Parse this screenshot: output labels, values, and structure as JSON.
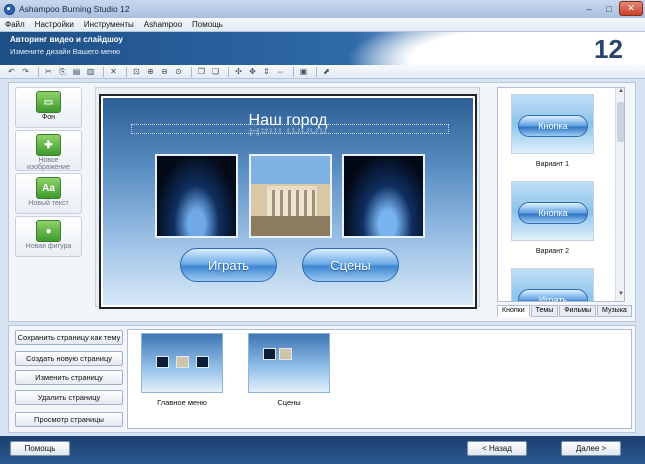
{
  "window": {
    "title": "Ashampoo Burning Studio 12",
    "controls": {
      "minimize": "–",
      "maximize": "□",
      "close": "✕"
    }
  },
  "menu": [
    "Файл",
    "Настройки",
    "Инструменты",
    "Ashampoo",
    "Помощь"
  ],
  "banner": {
    "title": "Авторинг видео и слайдшоу",
    "subtitle": "Измените дизайн Вашего меню",
    "version_badge": "12"
  },
  "toolbar_icons": [
    "undo-icon",
    "redo-icon",
    "cut-icon",
    "copy-icon",
    "paste-icon",
    "paste-special-icon",
    "delete-icon",
    "zoom-fit-icon",
    "zoom-in-icon",
    "zoom-out-icon",
    "zoom-select-icon",
    "group-icon",
    "ungroup-icon",
    "align-icon",
    "distribute-icon",
    "flip-vertical-icon",
    "flip-horizontal-icon",
    "save-icon",
    "preview-icon"
  ],
  "tools": [
    {
      "label": "Фон",
      "icon": "background-icon",
      "glyph": "▭"
    },
    {
      "label": "Новое изображение",
      "icon": "new-image-icon",
      "glyph": "✚"
    },
    {
      "label": "Новый текст",
      "icon": "new-text-icon",
      "glyph": "Aa"
    },
    {
      "label": "Новая фигура",
      "icon": "new-shape-icon",
      "glyph": "●"
    }
  ],
  "canvas": {
    "title": "Наш город",
    "buttons": [
      "Играть",
      "Сцены"
    ]
  },
  "variants": [
    {
      "button_text": "Кнопка",
      "label": "Вариант 1"
    },
    {
      "button_text": "Кнопка",
      "label": "Вариант 2"
    },
    {
      "button_text": "Играть",
      "label": ""
    }
  ],
  "tabs": [
    "Кнопки",
    "Темы",
    "Фильмы",
    "Музыка"
  ],
  "side_buttons": [
    "Сохранить страницу как тему",
    "Создать новую страницу",
    "Изменить страницу",
    "Удалить страницу",
    "Просмотр страницы"
  ],
  "pages": [
    "Главное меню",
    "Сцены"
  ],
  "footer": {
    "help": "Помощь",
    "back": "< Назад",
    "next": "Далее >"
  }
}
